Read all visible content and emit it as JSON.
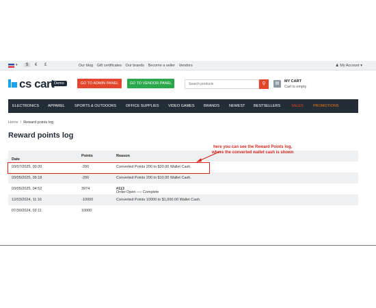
{
  "topbar": {
    "currencies": [
      "$",
      "€",
      "£"
    ],
    "links": [
      "Our blog",
      "Gift certificates",
      "Our brands",
      "Become a seller",
      "Vendors"
    ],
    "account": "My Account"
  },
  "header": {
    "logo_text": "cs cart",
    "badge": "Demo",
    "admin_button": "GO TO ADMIN PANEL",
    "vendor_button": "GO TO VENDOR PANEL",
    "search_placeholder": "Search products",
    "cart_title": "MY CART",
    "cart_status": "Cart is empty"
  },
  "nav": {
    "items": [
      "ELECTRONICS",
      "APPAREL",
      "SPORTS & OUTDOORS",
      "OFFICE SUPPLIES",
      "VIDEO GAMES",
      "BRANDS",
      "NEWEST",
      "BESTSELLERS",
      "SALES",
      "PROMOTIONS"
    ]
  },
  "breadcrumb": {
    "home": "Home",
    "separator": "/",
    "current": "Reward points log"
  },
  "page": {
    "title": "Reward points log"
  },
  "table": {
    "headers": [
      "Date",
      "Points",
      "Reason"
    ],
    "rows": [
      {
        "date": "03/07/2025, 00:20",
        "points": "-200",
        "reason": "Converted Points 200 to $20.00 Wallet Cash."
      },
      {
        "date": "03/05/2025, 05:18",
        "points": "-200",
        "reason": "Converted Points 200 to $10.00 Wallet Cash."
      },
      {
        "date": "03/05/2025, 04:52",
        "points": "3974",
        "reason_prefix": "Order ",
        "reason_order": "#113",
        "reason_suffix": ": Open —› Complete"
      },
      {
        "date": "12/03/2024, 11:16",
        "points": "-10000",
        "reason": "Converted Points 10000 to $1,000.00 Wallet Cash."
      },
      {
        "date": "07/30/2024, 02:11",
        "points": "10000",
        "reason": ""
      }
    ]
  },
  "annotation": {
    "line1": "here you can see the Reward Points log,",
    "line2": "where the converted wallet cash is shown",
    "color": "#d8261d"
  }
}
